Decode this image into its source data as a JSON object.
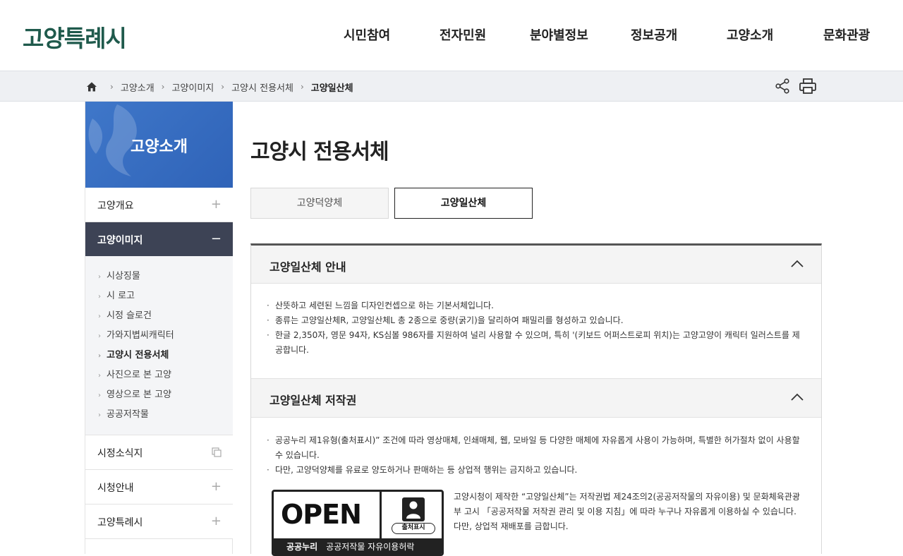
{
  "header": {
    "logo": "고양특례시",
    "nav": [
      "시민참여",
      "전자민원",
      "분야별정보",
      "정보공개",
      "고양소개",
      "문화관광"
    ]
  },
  "breadcrumb": {
    "items": [
      "고양소개",
      "고양이미지",
      "고양시 전용서체"
    ],
    "current": "고양일산체"
  },
  "sidebar": {
    "title": "고양소개",
    "top_item": {
      "label": "고양개요",
      "toggle": "+"
    },
    "active_item": {
      "label": "고양이미지",
      "toggle": "−"
    },
    "submenu": [
      "시상징물",
      "시 로고",
      "시정 슬로건",
      "가와지볍씨캐릭터",
      "고양시 전용서체",
      "사진으로 본 고양",
      "영상으로 본 고양",
      "공공저작물"
    ],
    "submenu_current_index": 4,
    "bottom_items": [
      {
        "label": "시정소식지",
        "toggle": ""
      },
      {
        "label": "시청안내",
        "toggle": "+"
      },
      {
        "label": "고양특례시",
        "toggle": "+"
      }
    ]
  },
  "main": {
    "title": "고양시 전용서체",
    "tabs": [
      {
        "label": "고양덕양체",
        "active": false
      },
      {
        "label": "고양일산체",
        "active": true
      }
    ],
    "section1": {
      "title": "고양일산체 안내",
      "lines": [
        "산뜻하고 세련된 느낌을 디자인컨셉으로 하는 기본서체입니다.",
        "종류는 고양일산체R, 고양일산체L 총 2종으로 중량(굵기)을 달리하여 패밀리를 형성하고 있습니다.",
        "한글 2,350자, 영문 94자, KS심볼 986자를 지원하여 널리 사용할 수 있으며, 특히 '(키보드 어퍼스트로피 위치)는 고양고양이 캐릭터 일러스트를 제공합니다."
      ]
    },
    "section2": {
      "title": "고양일산체 저작권",
      "lines": [
        "공공누리 제1유형(출처표시)” 조건에 따라 영상매체, 인쇄매체, 웹, 모바일 등 다양한 매체에 자유롭게 사용이 가능하며, 특별한 허가절차 없이 사용할 수 있습니다.",
        "다만, 고양덕양체를 유료로 양도하거나 판매하는 등 상업적 행위는 금지하고 있습니다."
      ],
      "badge": {
        "open": "OPEN",
        "attribution": "출처표시",
        "brand": "공공누리",
        "caption": "공공저작물 자유이용허락"
      },
      "copyright_text": "고양시청이 제작한 “고양일산체”는 저작권법 제24조의2(공공저작물의 자유이용) 및 문화체육관광부 고시 「공공저작물 저작권 관리 및 이용 지침」에 따라 누구나 자유롭게 이용하실 수 있습니다. 다만, 상업적 재배포를 금합니다."
    }
  },
  "colors": {
    "logo": "#1f5a4c",
    "sidebar_header": "#3f77c9",
    "sidebar_active": "#3d4355",
    "breadcrumb_bg": "#eef0f3"
  },
  "icons": [
    "home-icon",
    "share-icon",
    "print-icon",
    "chevron-up-icon",
    "new-window-icon"
  ]
}
